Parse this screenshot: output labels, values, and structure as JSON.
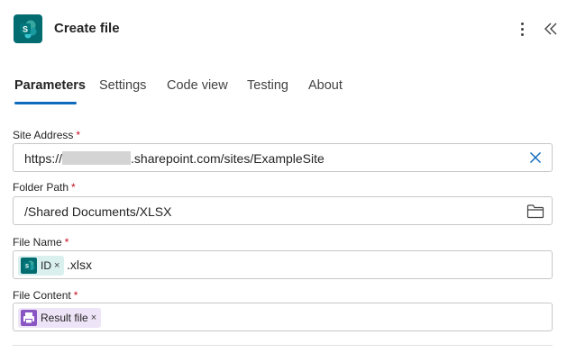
{
  "header": {
    "title": "Create file",
    "app_icon": "sharepoint-icon",
    "more_icon": "more-vertical-icon",
    "collapse_icon": "double-chevron-left-icon"
  },
  "tabs": [
    {
      "label": "Parameters",
      "active": true
    },
    {
      "label": "Settings",
      "active": false
    },
    {
      "label": "Code view",
      "active": false
    },
    {
      "label": "Testing",
      "active": false
    },
    {
      "label": "About",
      "active": false
    }
  ],
  "fields": {
    "site_address": {
      "label": "Site Address",
      "required_mark": "*",
      "value_prefix": "https://",
      "value_suffix": ".sharepoint.com/sites/ExampleSite"
    },
    "folder_path": {
      "label": "Folder Path",
      "required_mark": "*",
      "value": "/Shared Documents/XLSX"
    },
    "file_name": {
      "label": "File Name",
      "required_mark": "*",
      "token": {
        "label": "ID",
        "remove": "×"
      },
      "text_after": ".xlsx"
    },
    "file_content": {
      "label": "File Content",
      "required_mark": "*",
      "token": {
        "label": "Result file",
        "remove": "×"
      }
    }
  },
  "colors": {
    "accent": "#0f6cbd",
    "sharepoint": "#036c70",
    "power_platform": "#8a56c4",
    "required": "#c50f1f"
  }
}
